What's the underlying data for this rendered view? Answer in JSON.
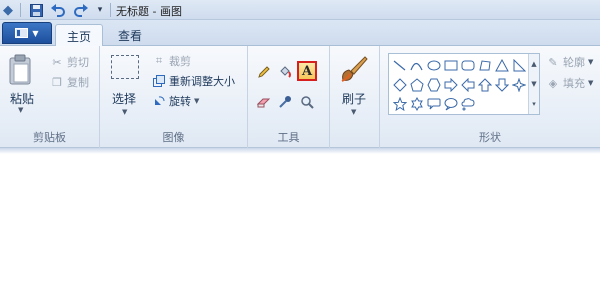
{
  "window": {
    "title": "无标题 - 画图"
  },
  "quick_access": [
    "app-icon",
    "save-icon",
    "undo-icon",
    "redo-icon",
    "customize-dropdown-icon"
  ],
  "tabs": [
    {
      "label": "主页",
      "active": true
    },
    {
      "label": "查看",
      "active": false
    }
  ],
  "ribbon": {
    "clipboard": {
      "group_label": "剪贴板",
      "paste_label": "粘贴",
      "cut_label": "剪切",
      "copy_label": "复制"
    },
    "image": {
      "group_label": "图像",
      "select_label": "选择",
      "crop_label": "裁剪",
      "resize_label": "重新调整大小",
      "rotate_label": "旋转"
    },
    "tools": {
      "group_label": "工具",
      "items": [
        "pencil-icon",
        "fill-icon",
        "text-icon",
        "eraser-icon",
        "color-picker-icon",
        "magnifier-icon"
      ],
      "text_glyph": "A",
      "selected": "text-icon"
    },
    "brushes": {
      "label": "刷子"
    },
    "shapes": {
      "group_label": "形状",
      "outline_label": "轮廓",
      "fill_label": "填充"
    }
  },
  "colors": {
    "selected_tool_border": "#d62020",
    "ribbon_bg": "#e7eef7",
    "file_button": "#1d4f9c"
  }
}
